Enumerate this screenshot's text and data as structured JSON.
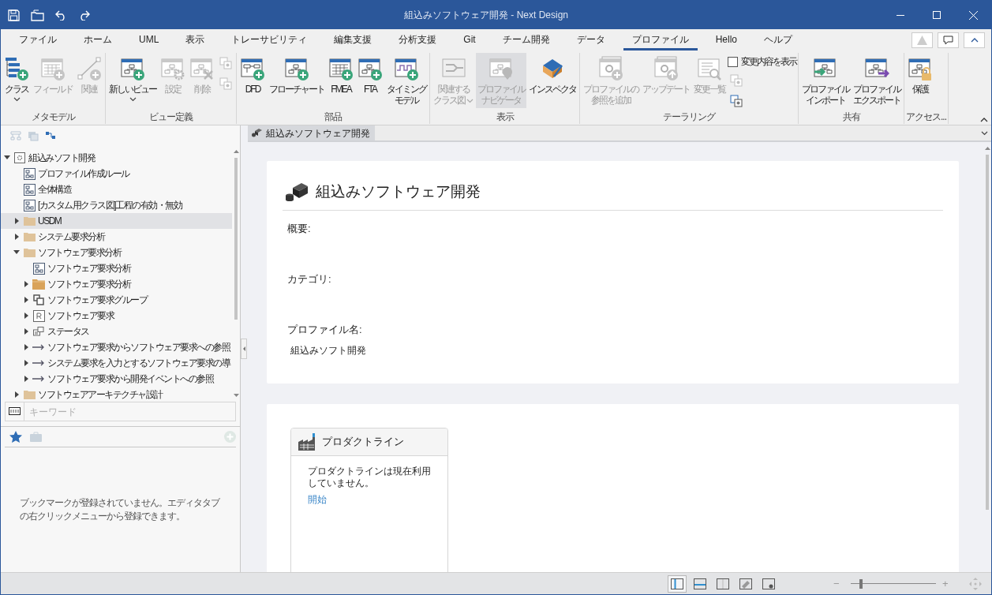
{
  "window": {
    "title": "組込みソフトウェア開発 - Next Design"
  },
  "menu_tabs": [
    {
      "label": "ファイル",
      "selected": false
    },
    {
      "label": "ホーム",
      "selected": false
    },
    {
      "label": "UML",
      "selected": false
    },
    {
      "label": "表示",
      "selected": false
    },
    {
      "label": "トレーサビリティ",
      "selected": false
    },
    {
      "label": "編集支援",
      "selected": false
    },
    {
      "label": "分析支援",
      "selected": false
    },
    {
      "label": "Git",
      "selected": false
    },
    {
      "label": "チーム開発",
      "selected": false
    },
    {
      "label": "データ",
      "selected": false
    },
    {
      "label": "プロファイル",
      "selected": true
    },
    {
      "label": "Hello",
      "selected": false
    },
    {
      "label": "ヘルプ",
      "selected": false
    }
  ],
  "ribbon": {
    "groups": [
      {
        "label": "メタモデル",
        "buttons": [
          {
            "kind": "large",
            "lines": [
              "クラス"
            ],
            "dropdown": true,
            "disabled": false,
            "pressed": false
          },
          {
            "kind": "large",
            "lines": [
              "フィールド"
            ],
            "dropdown": false,
            "disabled": true,
            "pressed": false
          },
          {
            "kind": "large",
            "lines": [
              "関連"
            ],
            "dropdown": false,
            "disabled": true,
            "pressed": false
          }
        ]
      },
      {
        "label": "ビュー定義",
        "buttons": [
          {
            "kind": "large",
            "lines": [
              "新しいビュー"
            ],
            "dropdown": true,
            "disabled": false,
            "pressed": false
          },
          {
            "kind": "large",
            "lines": [
              "設定"
            ],
            "dropdown": false,
            "disabled": true,
            "pressed": false
          },
          {
            "kind": "large",
            "lines": [
              "削除"
            ],
            "dropdown": false,
            "disabled": true,
            "pressed": false
          },
          {
            "kind": "small",
            "disabled": true
          },
          {
            "kind": "small",
            "disabled": true
          }
        ]
      },
      {
        "label": "部品",
        "buttons": [
          {
            "kind": "large",
            "lines": [
              "DFD"
            ],
            "dropdown": false,
            "disabled": false,
            "pressed": false
          },
          {
            "kind": "large",
            "lines": [
              "フローチャート"
            ],
            "dropdown": false,
            "disabled": false,
            "pressed": false
          },
          {
            "kind": "large",
            "lines": [
              "FMEA"
            ],
            "dropdown": false,
            "disabled": false,
            "pressed": false
          },
          {
            "kind": "large",
            "lines": [
              "FTA"
            ],
            "dropdown": false,
            "disabled": false,
            "pressed": false
          },
          {
            "kind": "large",
            "lines": [
              "タイミング",
              "モデル"
            ],
            "dropdown": false,
            "disabled": false,
            "pressed": false
          }
        ]
      },
      {
        "label": "表示",
        "buttons": [
          {
            "kind": "large",
            "lines": [
              "関連する",
              "クラス図"
            ],
            "dropdown": true,
            "disabled": true,
            "pressed": false
          },
          {
            "kind": "large",
            "lines": [
              "プロファイル",
              "ナビゲータ"
            ],
            "dropdown": false,
            "disabled": true,
            "pressed": true
          },
          {
            "kind": "large",
            "lines": [
              "インスペクタ"
            ],
            "dropdown": false,
            "disabled": false,
            "pressed": false
          }
        ]
      },
      {
        "label": "テーラリング",
        "buttons": [
          {
            "kind": "large",
            "lines": [
              "プロファイルの",
              "参照を追加"
            ],
            "dropdown": false,
            "disabled": true,
            "pressed": false
          },
          {
            "kind": "large",
            "lines": [
              "アップデート"
            ],
            "dropdown": false,
            "disabled": true,
            "pressed": false
          },
          {
            "kind": "large",
            "lines": [
              "変更一覧"
            ],
            "dropdown": false,
            "disabled": true,
            "pressed": false
          },
          {
            "kind": "checkbox",
            "label": "変更内容を表示",
            "checked": false
          },
          {
            "kind": "small",
            "disabled": true
          },
          {
            "kind": "small",
            "disabled": false
          }
        ]
      },
      {
        "label": "共有",
        "buttons": [
          {
            "kind": "large",
            "lines": [
              "プロファイル",
              "インポート"
            ],
            "dropdown": false,
            "disabled": false,
            "pressed": false
          },
          {
            "kind": "large",
            "lines": [
              "プロファイル",
              "エクスポート"
            ],
            "dropdown": false,
            "disabled": false,
            "pressed": false
          }
        ]
      },
      {
        "label": "アクセス...",
        "buttons": [
          {
            "kind": "large",
            "lines": [
              "保護"
            ],
            "dropdown": false,
            "disabled": false,
            "pressed": false
          }
        ]
      }
    ]
  },
  "navigator": {
    "tree": [
      {
        "label": "組込みソフト開発",
        "kind": "package",
        "expanded": true,
        "selected": false,
        "children": [
          {
            "label": "プロファイル作成ルール",
            "kind": "diagram",
            "selected": false
          },
          {
            "label": "全体構造",
            "kind": "diagram",
            "selected": false
          },
          {
            "label": "[カスタム用クラス図]工程の有効・無効",
            "kind": "diagram",
            "selected": false
          },
          {
            "label": "USDM",
            "kind": "folder",
            "expanded": false,
            "selected": true
          },
          {
            "label": "システム要求分析",
            "kind": "folder",
            "expanded": false,
            "selected": false
          },
          {
            "label": "ソフトウェア要求分析",
            "kind": "folder",
            "expanded": true,
            "selected": false,
            "children": [
              {
                "label": "ソフトウェア要求分析",
                "kind": "diagram",
                "selected": false
              },
              {
                "label": "ソフトウェア要求分析",
                "kind": "class-folder",
                "expanded": false,
                "selected": false
              },
              {
                "label": "ソフトウェア要求グループ",
                "kind": "group",
                "expanded": false,
                "selected": false
              },
              {
                "label": "ソフトウェア要求",
                "kind": "requirement",
                "expanded": false,
                "selected": false
              },
              {
                "label": "ステータス",
                "kind": "status",
                "expanded": false,
                "selected": false
              },
              {
                "label": "ソフトウェア要求からソフトウェア要求への参照",
                "kind": "reference",
                "expanded": false,
                "selected": false
              },
              {
                "label": "システム要求を入力とするソフトウェア要求の導",
                "kind": "reference",
                "expanded": false,
                "selected": false
              },
              {
                "label": "ソフトウェア要求から開発イベントへの参照",
                "kind": "reference",
                "expanded": false,
                "selected": false
              }
            ]
          },
          {
            "label": "ソフトウェアアーキテクチャ設計",
            "kind": "folder",
            "expanded": false,
            "selected": false
          }
        ]
      }
    ],
    "search": {
      "placeholder": "キーワード"
    },
    "bookmark_tabs": [
      {
        "selected": true
      },
      {
        "selected": false
      }
    ],
    "bookmarks_message": "ブックマークが登録されていません。エディタタブの右クリックメニューから登録できます。"
  },
  "editor": {
    "tabs": [
      {
        "label": "組込みソフトウェア開発",
        "selected": true
      }
    ],
    "heading": "組込みソフトウェア開発",
    "fields": [
      {
        "label": "概要:"
      },
      {
        "label": "カテゴリ:"
      },
      {
        "label": "プロファイル名:",
        "value": "組込みソフト開発"
      }
    ],
    "product_line": {
      "title": "プロダクトライン",
      "message": "プロダクトラインは現在利用していません。",
      "link": "開始"
    }
  },
  "status_bar": {
    "layout_buttons": [
      {
        "selected": true
      },
      {
        "selected": false
      },
      {
        "selected": false
      },
      {
        "selected": false
      },
      {
        "selected": false
      }
    ],
    "zoom": {
      "minus": "−",
      "plus": "+",
      "level": 0.1
    }
  }
}
